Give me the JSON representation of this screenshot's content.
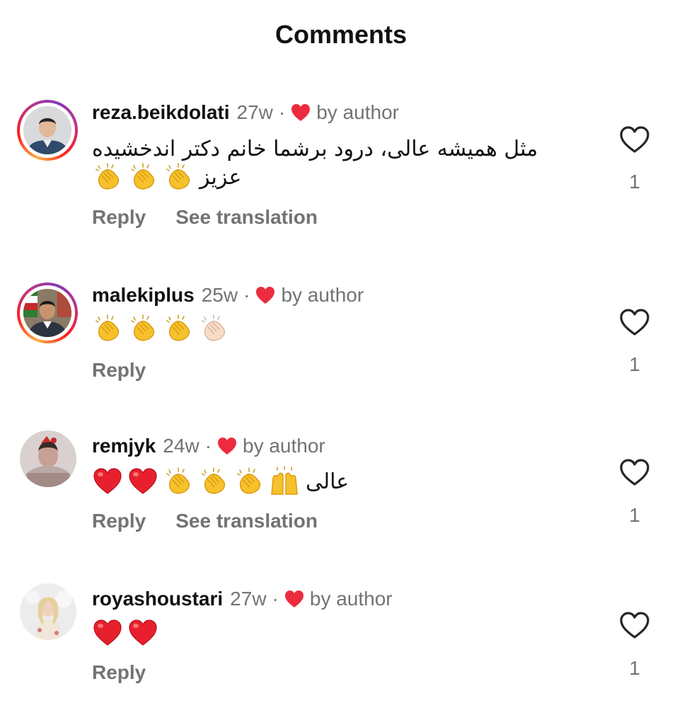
{
  "header": {
    "title": "Comments"
  },
  "colors": {
    "author_heart": "#ed2b3f",
    "muted": "#737373",
    "text": "#111111"
  },
  "comments": [
    {
      "username": "reza.beikdolati",
      "time": "27w",
      "dot": "·",
      "liked_by_author_icon": "red-heart-icon",
      "by_author": "by author",
      "text_line1": "مثل همیشه عالی، درود برشما خانم دکتر اندخشیده",
      "text_line2": "عزیز",
      "emojis": [
        "clap",
        "clap",
        "clap"
      ],
      "reply": "Reply",
      "see_translation": "See translation",
      "likes": "1",
      "avatar_ring": true
    },
    {
      "username": "malekiplus",
      "time": "25w",
      "dot": "·",
      "liked_by_author_icon": "red-heart-icon",
      "by_author": "by author",
      "emojis": [
        "clap",
        "clap",
        "clap",
        "clap-light"
      ],
      "reply": "Reply",
      "likes": "1",
      "avatar_ring": true
    },
    {
      "username": "remjyk",
      "time": "24w",
      "dot": "·",
      "liked_by_author_icon": "red-heart-icon",
      "by_author": "by author",
      "text": "عالی",
      "emojis": [
        "red-heart",
        "red-heart",
        "clap",
        "clap",
        "clap",
        "raising-hands"
      ],
      "reply": "Reply",
      "see_translation": "See translation",
      "likes": "1",
      "avatar_ring": false
    },
    {
      "username": "royashoustari",
      "time": "27w",
      "dot": "·",
      "liked_by_author_icon": "red-heart-icon",
      "by_author": "by author",
      "emojis": [
        "red-heart",
        "red-heart"
      ],
      "reply": "Reply",
      "likes": "1",
      "avatar_ring": false
    }
  ]
}
